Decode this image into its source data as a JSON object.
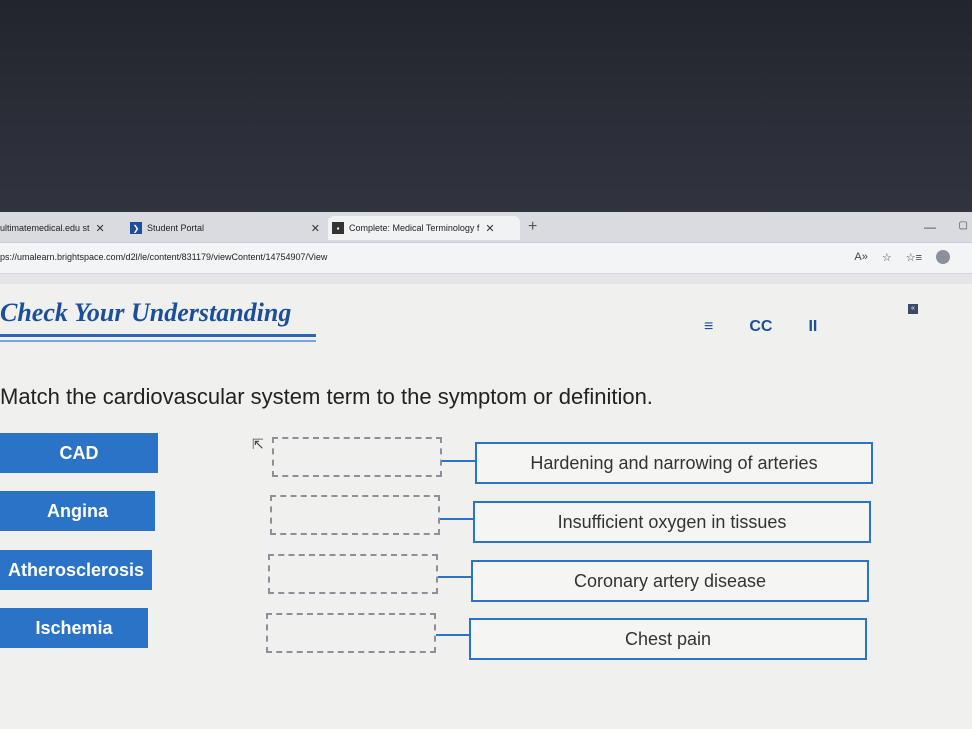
{
  "browser": {
    "tabs": [
      {
        "title": "ultimatemedical.edu st",
        "close": "✕"
      },
      {
        "title": "Student Portal",
        "close": "✕"
      },
      {
        "title": "Complete: Medical Terminology f",
        "close": "✕"
      }
    ],
    "new_tab": "+",
    "url": "ps://umalearn.brightspace.com/d2l/le/content/831179/viewContent/14754907/View"
  },
  "activity": {
    "title": "Check Your Understanding",
    "controls": {
      "menu": "≡",
      "captions": "CC",
      "pause": "II"
    },
    "instruction": "Match the cardiovascular system term to the symptom or definition.",
    "terms": [
      "CAD",
      "Angina",
      "Atherosclerosis",
      "Ischemia"
    ],
    "definitions": [
      "Hardening and narrowing of arteries",
      "Insufficient oxygen in tissues",
      "Coronary artery disease",
      "Chest pain"
    ]
  },
  "colors": {
    "accent": "#2a73c7",
    "title": "#1c4f99"
  }
}
